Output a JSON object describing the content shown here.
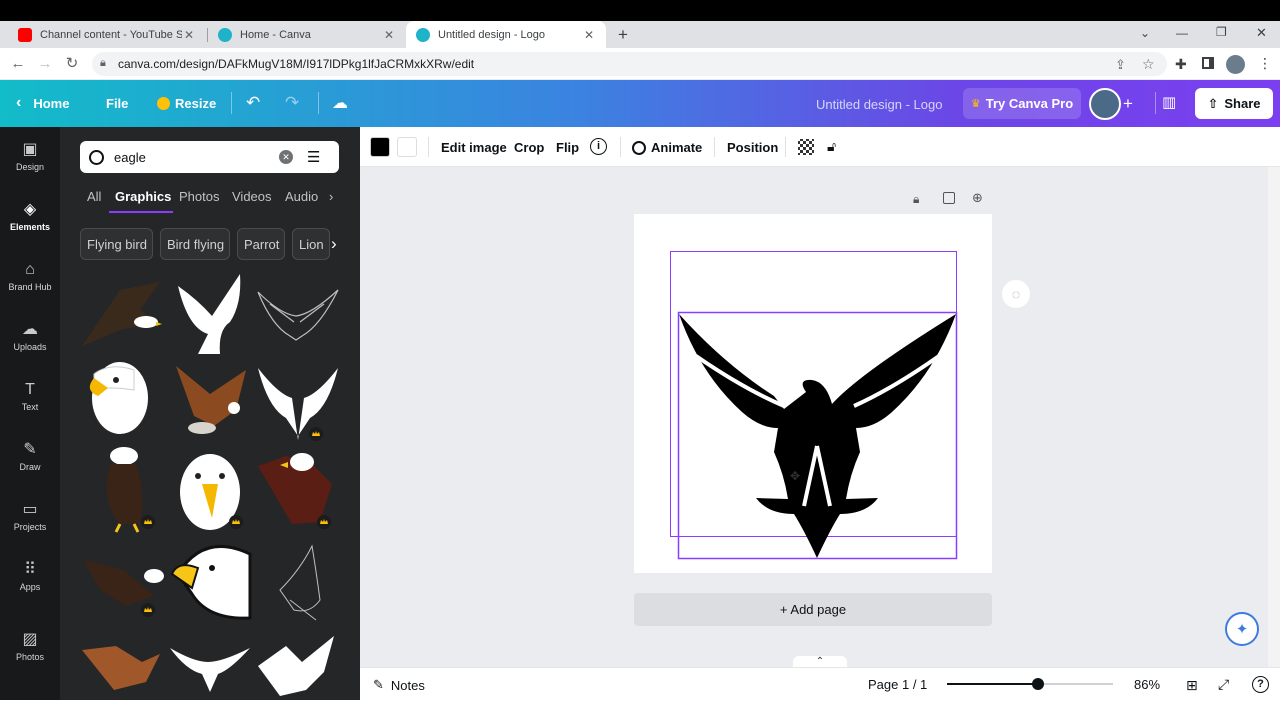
{
  "browser": {
    "tabs": [
      {
        "title": "Channel content - YouTube Studi",
        "favicon_color": "#ff0000",
        "active": false
      },
      {
        "title": "Home - Canva",
        "favicon_color": "#1fb3c9",
        "active": false
      },
      {
        "title": "Untitled design - Logo",
        "favicon_color": "#1fb3c9",
        "active": true
      }
    ],
    "new_tab_symbol": "+",
    "url": "canva.com/design/DAFkMugV18M/I917lDPkg1lfJaCRMxkXRw/edit"
  },
  "header": {
    "home_label": "Home",
    "file_label": "File",
    "resize_label": "Resize",
    "design_title": "Untitled design - Logo",
    "try_pro_label": "Try Canva Pro",
    "share_label": "Share"
  },
  "rail": {
    "items": [
      {
        "label": "Design",
        "icon": "design-icon",
        "glyph": "▣"
      },
      {
        "label": "Elements",
        "icon": "elements-icon",
        "glyph": "◈"
      },
      {
        "label": "Brand Hub",
        "icon": "brand-hub-icon",
        "glyph": "⌂"
      },
      {
        "label": "Uploads",
        "icon": "uploads-icon",
        "glyph": "☁"
      },
      {
        "label": "Text",
        "icon": "text-icon",
        "glyph": "T"
      },
      {
        "label": "Draw",
        "icon": "draw-icon",
        "glyph": "✎"
      },
      {
        "label": "Projects",
        "icon": "projects-icon",
        "glyph": "▭"
      },
      {
        "label": "Apps",
        "icon": "apps-icon",
        "glyph": "⠿"
      },
      {
        "label": "Photos",
        "icon": "photos-icon",
        "glyph": "▨"
      }
    ],
    "active_index": 1
  },
  "panel": {
    "search_value": "eagle",
    "tabs": [
      "All",
      "Graphics",
      "Photos",
      "Videos",
      "Audio"
    ],
    "active_tab": "Graphics",
    "chips": [
      "Flying bird",
      "Bird flying",
      "Parrot",
      "Lion"
    ]
  },
  "toolbar": {
    "edit_image": "Edit image",
    "crop": "Crop",
    "flip": "Flip",
    "animate": "Animate",
    "position": "Position",
    "fill_color_1": "#000000",
    "fill_color_2": "#ffffff"
  },
  "canvas": {
    "add_page_label": "+ Add page",
    "selection_color": "#8b3dff"
  },
  "bottom": {
    "notes_label": "Notes",
    "page_indicator": "Page 1 / 1",
    "zoom_label": "86%",
    "zoom_fraction": 0.55
  }
}
